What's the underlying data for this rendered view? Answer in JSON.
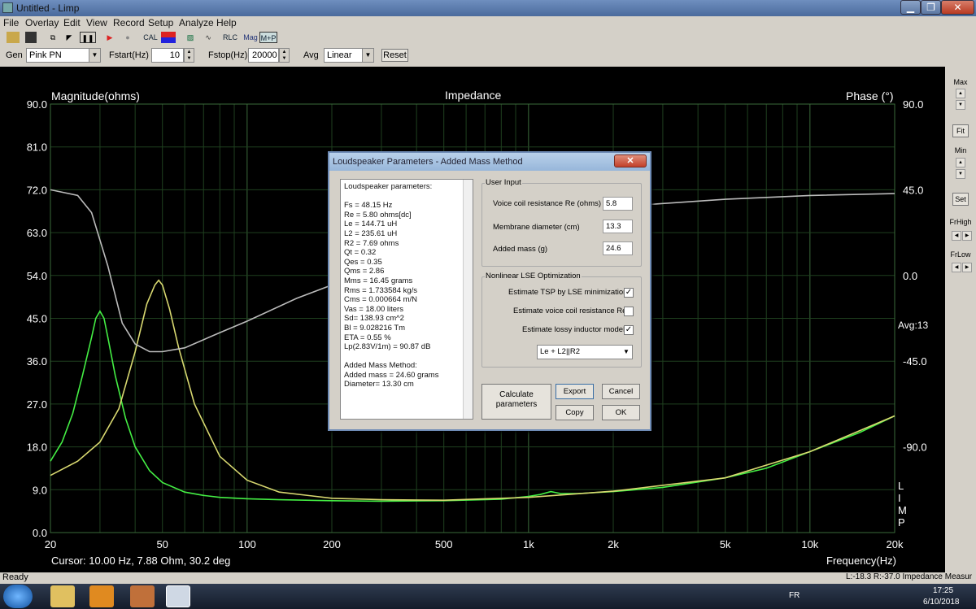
{
  "window": {
    "title": "Untitled - Limp"
  },
  "menu": [
    "File",
    "Overlay",
    "Edit",
    "View",
    "Record",
    "Setup",
    "Analyze",
    "Help"
  ],
  "toolbar": {
    "cal": "CAL",
    "rlc": "RLC",
    "mag": "Mag",
    "mp": "M+P"
  },
  "gen": {
    "gen_label": "Gen",
    "gen_value": "Pink PN",
    "fstart_label": "Fstart(Hz)",
    "fstart_value": "10",
    "fstop_label": "Fstop(Hz)",
    "fstop_value": "20000",
    "avg_label": "Avg",
    "avg_value": "Linear",
    "reset_label": "Reset"
  },
  "plot": {
    "left_title": "Magnitude(ohms)",
    "center_title": "Impedance",
    "right_title": "Phase (°)",
    "cursor": "Cursor: 10.00 Hz, 7.88 Ohm, 30.2 deg",
    "xlabel": "Frequency(Hz)",
    "avg_text": "Avg:13",
    "limp_vertical": [
      "L",
      "I",
      "M",
      "P"
    ]
  },
  "right_panel": {
    "max": "Max",
    "fit": "Fit",
    "min": "Min",
    "set": "Set",
    "frhigh": "FrHigh",
    "frlow": "FrLow"
  },
  "chart_data": {
    "type": "line",
    "xscale": "log",
    "xlim": [
      20,
      20000
    ],
    "ylim_left": [
      0,
      90
    ],
    "ylim_right": [
      -135,
      90
    ],
    "x_ticks": [
      "20",
      "50",
      "100",
      "200",
      "500",
      "1k",
      "2k",
      "5k",
      "10k",
      "20k"
    ],
    "x_tick_values": [
      20,
      50,
      100,
      200,
      500,
      1000,
      2000,
      5000,
      10000,
      20000
    ],
    "y_left_ticks": [
      "90.0",
      "81.0",
      "72.0",
      "63.0",
      "54.0",
      "45.0",
      "36.0",
      "27.0",
      "18.0",
      "9.0",
      "0.0"
    ],
    "y_right_ticks": [
      "90.0",
      "45.0",
      "0.0",
      "-45.0",
      "-90.0"
    ],
    "series": [
      {
        "color": "#44ee44",
        "axis": "left",
        "x": [
          20,
          22,
          24,
          26,
          28,
          29,
          30,
          31,
          32,
          34,
          37,
          40,
          45,
          50,
          60,
          70,
          80,
          100,
          130,
          200,
          300,
          500,
          800,
          1000,
          1100,
          1200,
          1300,
          1500,
          2000,
          3000,
          5000,
          7000,
          10000,
          15000,
          20000
        ],
        "y": [
          15,
          19,
          25,
          33,
          41,
          45,
          46.5,
          45,
          41,
          33,
          24,
          18,
          13,
          10.5,
          8.5,
          7.8,
          7.4,
          7.1,
          6.9,
          6.7,
          6.6,
          6.7,
          7.0,
          7.6,
          8.0,
          8.6,
          8.2,
          8.2,
          8.6,
          9.5,
          11.5,
          13.5,
          17,
          21,
          24.5
        ]
      },
      {
        "color": "#d8d870",
        "axis": "left",
        "x": [
          20,
          25,
          30,
          35,
          40,
          44,
          47,
          48.5,
          50,
          53,
          57,
          65,
          80,
          100,
          130,
          200,
          300,
          500,
          1000,
          2000,
          5000,
          10000,
          20000
        ],
        "y": [
          12,
          15,
          19,
          26,
          38,
          48,
          52,
          53,
          52,
          47,
          39,
          27,
          16,
          11,
          8.5,
          7.2,
          6.9,
          6.8,
          7.4,
          8.7,
          11.5,
          17,
          24.5
        ]
      },
      {
        "color": "#bbbbbb",
        "axis": "right",
        "x": [
          20,
          25,
          28,
          32,
          36,
          40,
          45,
          50,
          60,
          80,
          100,
          150,
          200,
          300,
          500,
          800,
          1000,
          2000,
          5000,
          10000,
          20000
        ],
        "y": [
          45,
          42,
          33,
          5,
          -25,
          -36,
          -40,
          -40,
          -38,
          -30,
          -24,
          -12,
          -5,
          6,
          18,
          26,
          30,
          36,
          40,
          42,
          43
        ]
      }
    ]
  },
  "dialog": {
    "title": "Loudspeaker Parameters - Added Mass Method",
    "close": "✕",
    "params": [
      "Loudspeaker parameters:",
      "",
      "Fs  = 48.15 Hz",
      "Re  = 5.80 ohms[dc]",
      "Le  = 144.71 uH",
      "L2  = 235.61 uH",
      "R2  = 7.69 ohms",
      "Qt  = 0.32",
      "Qes = 0.35",
      "Qms = 2.86",
      "Mms = 16.45 grams",
      "Rms = 1.733584 kg/s",
      "Cms = 0.000664 m/N",
      "Vas = 18.00 liters",
      "Sd= 138.93 cm^2",
      "Bl  = 9.028216 Tm",
      "ETA = 0.55 %",
      "Lp(2.83V/1m) = 90.87 dB",
      "",
      "Added Mass Method:",
      "Added mass = 24.60 grams",
      "Diameter= 13.30 cm"
    ],
    "user_input": "User Input",
    "re_label": "Voice coil resistance Re (ohms)",
    "re_value": "5.8",
    "diam_label": "Membrane diameter (cm)",
    "diam_value": "13.3",
    "mass_label": "Added mass (g)",
    "mass_value": "24.6",
    "lse": "Nonlinear LSE Optimization",
    "chk1_label": "Estimate TSP by LSE minimization",
    "chk1": true,
    "chk2_label": "Estimate voice coil resistance Re",
    "chk2": false,
    "chk3_label": "Estimate lossy inductor model",
    "chk3": true,
    "model": "Le + L2||R2",
    "calc": "Calculate parameters",
    "export": "Export",
    "cancel": "Cancel",
    "copy": "Copy",
    "ok": "OK"
  },
  "status": {
    "left": "Ready",
    "right": "L:-18.3  R:-37.0  Impedance Measur"
  },
  "taskbar": {
    "lang": "FR",
    "time": "17:25",
    "date": "6/10/2018"
  }
}
